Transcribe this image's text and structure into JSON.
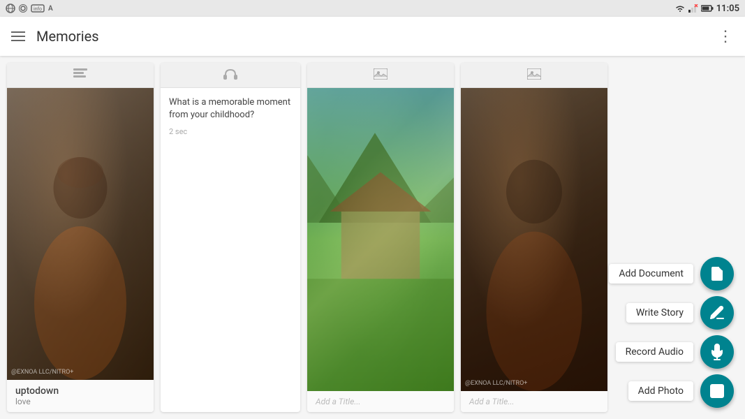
{
  "statusBar": {
    "time": "11:05",
    "icons": [
      "wifi",
      "signal",
      "battery"
    ]
  },
  "appBar": {
    "title": "Memories",
    "menuIcon": "hamburger-icon",
    "moreIcon": "more-options-icon"
  },
  "cards": [
    {
      "id": "card-1",
      "type": "image",
      "headerIcon": "text-icon",
      "imageType": "anime",
      "name": "uptodown",
      "subtitle": "love",
      "watermark": "@EXNOA LLC/NITRO+"
    },
    {
      "id": "card-2",
      "type": "audio",
      "headerIcon": "headphone-icon",
      "question": "What is a memorable moment from your childhood?",
      "timestamp": "2 sec"
    },
    {
      "id": "card-3",
      "type": "image",
      "headerIcon": "image-icon",
      "imageType": "game",
      "titlePlaceholder": "Add a Title..."
    },
    {
      "id": "card-4",
      "type": "image",
      "headerIcon": "image-icon",
      "imageType": "anime",
      "titlePlaceholder": "Add a Title...",
      "watermark": "@EXNOA LLC/NITRO+"
    }
  ],
  "fabMenu": {
    "items": [
      {
        "id": "add-document",
        "label": "Add Document",
        "icon": "document-icon"
      },
      {
        "id": "write-story",
        "label": "Write Story",
        "icon": "write-icon"
      },
      {
        "id": "record-audio",
        "label": "Record Audio",
        "icon": "mic-icon"
      },
      {
        "id": "add-photo",
        "label": "Add Photo",
        "icon": "photo-icon"
      }
    ]
  }
}
